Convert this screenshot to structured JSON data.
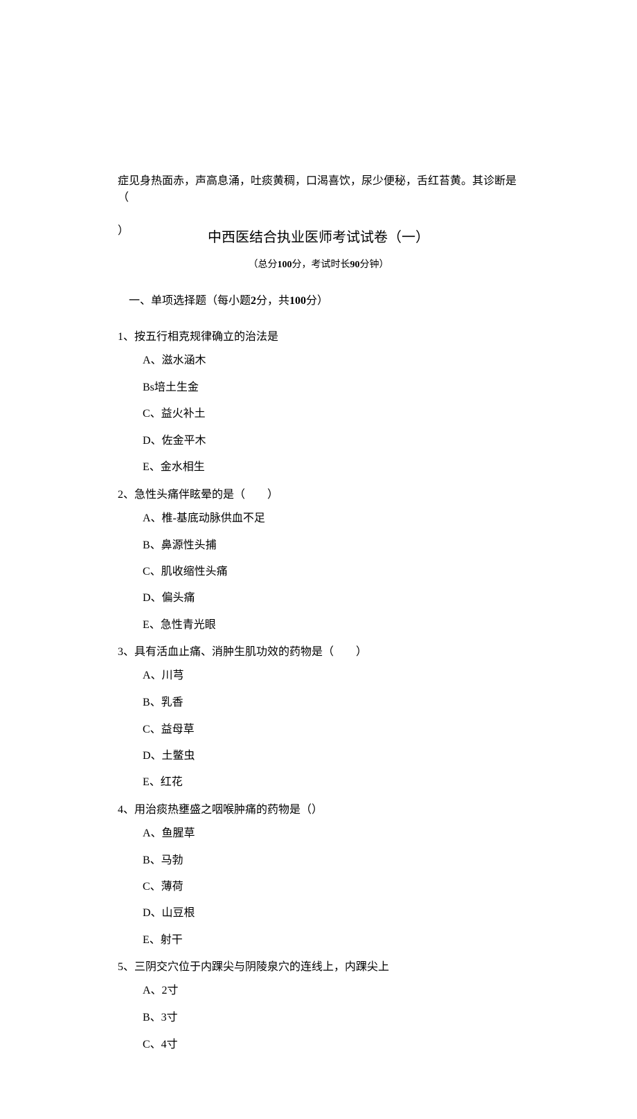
{
  "stray_top": "症见身热面赤，声高息涌，吐痰黄稠，口渴喜饮，尿少便秘，舌红苔黄。其诊断是（",
  "stray_paren": "）",
  "title": "中西医结合执业医师考试试卷（一）",
  "subtitle_prefix": "（总分",
  "subtitle_score": "100",
  "subtitle_mid": "分，考试时长",
  "subtitle_minutes": "90",
  "subtitle_suffix": "分钟）",
  "section_heading_prefix": "一、单项选择题（每小题",
  "section_heading_per": "2",
  "section_heading_mid": "分，共",
  "section_heading_total": "100",
  "section_heading_suffix": "分）",
  "questions": [
    {
      "num": "1",
      "stem": "、按五行相克规律确立的治法是",
      "opts": [
        "A、滋水涵木",
        "Bs培土生金",
        "C、益火补土",
        "D、佐金平木",
        "E、金水相生"
      ]
    },
    {
      "num": "2",
      "stem": "、急性头痛伴眩晕的是（　　）",
      "opts": [
        "A、椎-基底动脉供血不足",
        "B、鼻源性头捕",
        "C、肌收缩性头痛",
        "D、偏头痛",
        "E、急性青光眼"
      ]
    },
    {
      "num": "3",
      "stem": "、具有活血止痛、消肿生肌功效的药物是（　　）",
      "opts": [
        "A、川芎",
        "B、乳香",
        "C、益母草",
        "D、土鳖虫",
        "E、红花"
      ]
    },
    {
      "num": "4",
      "stem": "、用治痰热壅盛之咽喉肿痛的药物是（）",
      "opts": [
        "A、鱼腥草",
        "B、马勃",
        "C、薄荷",
        "D、山豆根",
        "E、射干"
      ]
    },
    {
      "num": "5",
      "stem": "、三阴交穴位于内踝尖与阴陵泉穴的连线上，内踝尖上",
      "opts": [
        "A、2寸",
        "B、3寸",
        "C、4寸"
      ]
    }
  ]
}
